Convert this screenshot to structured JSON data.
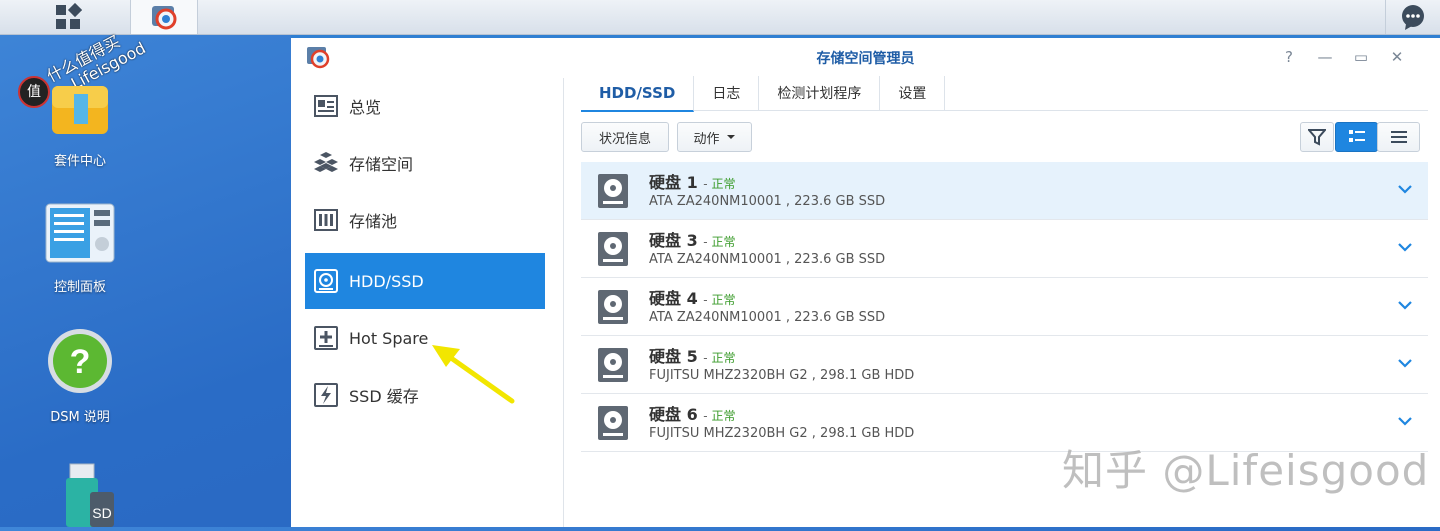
{
  "desktop": {
    "watermark_tl_line1": "什么值得买",
    "watermark_tl_line2": "Lifeisgood",
    "icons": [
      {
        "label": "套件中心"
      },
      {
        "label": "控制面板"
      },
      {
        "label": "DSM 说明"
      },
      {
        "label": ""
      }
    ]
  },
  "window": {
    "title": "存储空间管理员",
    "controls": {
      "help": "?",
      "minimize": "—",
      "maximize": "▭",
      "close": "✕"
    }
  },
  "sidebar": {
    "items": [
      {
        "label": "总览",
        "icon": "overview-icon"
      },
      {
        "label": "存储空间",
        "icon": "storage-volume-icon"
      },
      {
        "label": "存储池",
        "icon": "storage-pool-icon"
      },
      {
        "label": "HDD/SSD",
        "icon": "hdd-icon",
        "active": true
      },
      {
        "label": "Hot Spare",
        "icon": "hot-spare-icon"
      },
      {
        "label": "SSD 缓存",
        "icon": "ssd-cache-icon"
      }
    ]
  },
  "tabs": [
    {
      "label": "HDD/SSD",
      "active": true
    },
    {
      "label": "日志"
    },
    {
      "label": "检测计划程序"
    },
    {
      "label": "设置"
    }
  ],
  "toolbar": {
    "status_info": "状况信息",
    "action": "动作",
    "filter_icon": "filter-icon",
    "view_list_icon": "list-view-icon",
    "view_compact_icon": "compact-view-icon"
  },
  "disks": [
    {
      "name": "硬盘 1",
      "status": "正常",
      "desc": "ATA ZA240NM10001 , 223.6 GB SSD",
      "selected": true
    },
    {
      "name": "硬盘 3",
      "status": "正常",
      "desc": "ATA ZA240NM10001 , 223.6 GB SSD"
    },
    {
      "name": "硬盘 4",
      "status": "正常",
      "desc": "ATA ZA240NM10001 , 223.6 GB SSD"
    },
    {
      "name": "硬盘 5",
      "status": "正常",
      "desc": "FUJITSU MHZ2320BH G2 , 298.1 GB HDD"
    },
    {
      "name": "硬盘 6",
      "status": "正常",
      "desc": "FUJITSU MHZ2320BH G2 , 298.1 GB HDD"
    }
  ],
  "colors": {
    "accent": "#1f86e0",
    "status_ok": "#3a9b2a",
    "annotation_arrow": "#f2e600"
  },
  "watermark_br": "知乎 @Lifeisgood"
}
